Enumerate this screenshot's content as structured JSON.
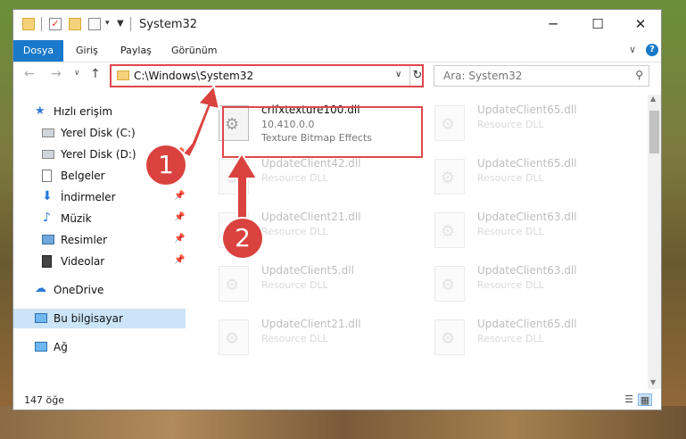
{
  "titlebar": {
    "title": "System32",
    "minimize": "─",
    "maximize": "☐",
    "close": "✕"
  },
  "ribbon": {
    "tabs": [
      "Dosya",
      "Giriş",
      "Paylaş",
      "Görünüm"
    ],
    "expand": "∨",
    "help": "?"
  },
  "address": {
    "path": "C:\\Windows\\System32",
    "dropdown": "∨",
    "refresh": "↻"
  },
  "search": {
    "placeholder": "Ara: System32"
  },
  "nav": {
    "items": [
      {
        "label": "Hızlı erişim",
        "icon": "star-icon"
      },
      {
        "label": "Yerel Disk (C:)",
        "icon": "drive-icon"
      },
      {
        "label": "Yerel Disk (D:)",
        "icon": "drive-icon"
      },
      {
        "label": "Belgeler",
        "icon": "documents-icon"
      },
      {
        "label": "İndirmeler",
        "icon": "download-icon"
      },
      {
        "label": "Müzik",
        "icon": "music-icon"
      },
      {
        "label": "Resimler",
        "icon": "pictures-icon"
      },
      {
        "label": "Videolar",
        "icon": "videos-icon"
      },
      {
        "label": "OneDrive",
        "icon": "cloud-icon"
      },
      {
        "label": "Bu bilgisayar",
        "icon": "computer-icon"
      },
      {
        "label": "Ağ",
        "icon": "network-icon"
      }
    ]
  },
  "files": [
    {
      "name": "crlfxtexture100.dll",
      "line1": "10.410.0.0",
      "line2": "Texture Bitmap Effects"
    },
    {
      "name": "UpdateClient65.dll",
      "line1": "Resource DLL"
    },
    {
      "name": "UpdateClient42.dll",
      "line1": "Resource DLL"
    },
    {
      "name": "UpdateClient65.dll",
      "line1": "Resource DLL"
    },
    {
      "name": "UpdateClient21.dll",
      "line1": "Resource DLL"
    },
    {
      "name": "UpdateClient63.dll",
      "line1": "Resource DLL"
    },
    {
      "name": "UpdateClient5.dll",
      "line1": "Resource DLL"
    },
    {
      "name": "UpdateClient63.dll",
      "line1": "Resource DLL"
    },
    {
      "name": "UpdateClient21.dll",
      "line1": "Resource DLL"
    },
    {
      "name": "UpdateClient65.dll",
      "line1": "Resource DLL"
    }
  ],
  "status": {
    "count": "147 öğe"
  },
  "callouts": [
    "1",
    "2"
  ],
  "colors": {
    "accent": "#1979ca",
    "highlight": "#e0474c",
    "selected": "#cce4f7"
  }
}
